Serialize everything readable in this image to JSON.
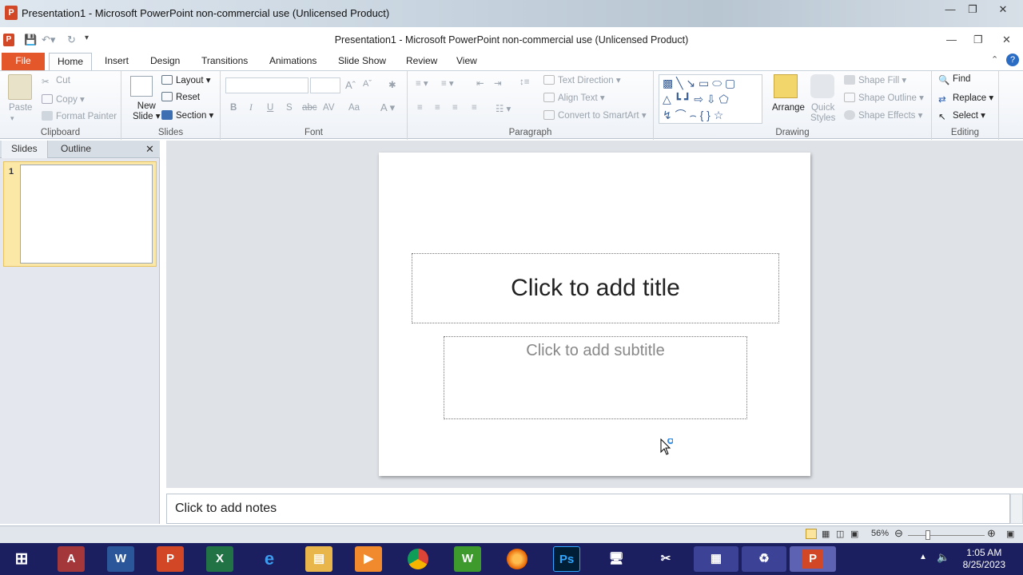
{
  "window": {
    "outer_title": "Presentation1 - Microsoft PowerPoint non-commercial use (Unlicensed Product)",
    "inner_title": "Presentation1  -  Microsoft PowerPoint non-commercial use (Unlicensed Product)"
  },
  "tabs": [
    "File",
    "Home",
    "Insert",
    "Design",
    "Transitions",
    "Animations",
    "Slide Show",
    "Review",
    "View"
  ],
  "ribbon": {
    "clipboard": {
      "paste": "Paste",
      "cut": "Cut",
      "copy": "Copy",
      "format_painter": "Format Painter",
      "label": "Clipboard"
    },
    "slides": {
      "new_slide_1": "New",
      "new_slide_2": "Slide",
      "layout": "Layout",
      "reset": "Reset",
      "section": "Section",
      "label": "Slides"
    },
    "font": {
      "bold": "B",
      "italic": "I",
      "underline": "U",
      "shadow": "S",
      "strike": "abc",
      "spacing": "AV",
      "case": "Aa",
      "label": "Font"
    },
    "paragraph": {
      "text_direction": "Text Direction",
      "align_text": "Align Text",
      "smartart": "Convert to SmartArt",
      "label": "Paragraph"
    },
    "drawing": {
      "arrange": "Arrange",
      "quick_styles_1": "Quick",
      "quick_styles_2": "Styles",
      "shape_fill": "Shape Fill",
      "shape_outline": "Shape Outline",
      "shape_effects": "Shape Effects",
      "label": "Drawing"
    },
    "editing": {
      "find": "Find",
      "replace": "Replace",
      "select": "Select",
      "label": "Editing"
    }
  },
  "left_pane": {
    "tab_slides": "Slides",
    "tab_outline": "Outline",
    "slide_number": "1"
  },
  "slide": {
    "title_placeholder": "Click to add title",
    "subtitle_placeholder": "Click to add subtitle"
  },
  "notes": {
    "placeholder": "Click to add notes"
  },
  "status": {
    "zoom": "56%"
  },
  "taskbar": {
    "time": "1:05 AM",
    "date": "8/25/2023",
    "apps": [
      "start",
      "access",
      "word",
      "powerpoint",
      "excel",
      "internet-explorer",
      "file-explorer",
      "media-player",
      "chrome",
      "games",
      "firefox",
      "photoshop",
      "network",
      "snipping-tool",
      "control-panel",
      "recycle",
      "powerpoint-active"
    ]
  },
  "colors": {
    "file_tab": "#e3572b",
    "taskbar": "#1b1f5f",
    "selection": "#fbe8a6"
  }
}
